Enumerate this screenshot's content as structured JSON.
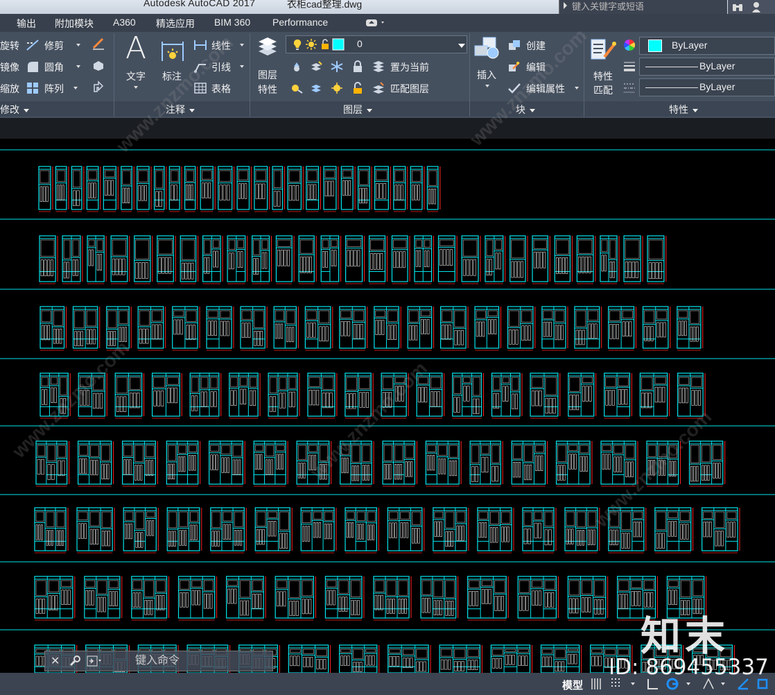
{
  "titlebar": {
    "app_title": "Autodesk AutoCAD 2017",
    "file_name": "衣柜cad整理.dwg",
    "search_placeholder": "键入关键字或短语"
  },
  "tabs": [
    "输出",
    "附加模块",
    "A360",
    "精选应用",
    "BIM 360",
    "Performance"
  ],
  "ribbon": {
    "modify": {
      "rotate": "旋转",
      "mirror": "镜像",
      "scale": "缩放",
      "trim": "修剪",
      "fillet": "圆角",
      "array": "阵列",
      "title": "修改"
    },
    "annotation": {
      "text": "文字",
      "dimension": "标注",
      "linear": "线性",
      "leader": "引线",
      "table": "表格",
      "title": "注释"
    },
    "layers": {
      "layer_properties": "图层\n特性",
      "layer_properties_l1": "图层",
      "layer_properties_l2": "特性",
      "current_layer": "0",
      "set_current": "置为当前",
      "match_layer": "匹配图层",
      "title": "图层",
      "layer_color": "#00e5ee"
    },
    "block": {
      "insert": "插入",
      "create": "创建",
      "edit": "编辑",
      "edit_attributes": "编辑属性",
      "title": "块"
    },
    "properties": {
      "match_l1": "特性",
      "match_l2": "匹配",
      "color": "ByLayer",
      "linetype": "ByLayer",
      "lineweight": "ByLayer",
      "title": "特性",
      "color_swatch": "#00ffff"
    }
  },
  "command": {
    "placeholder": "键入命令"
  },
  "status": {
    "model_tab": "模型"
  },
  "watermark": {
    "logo": "知末",
    "id": "ID: 869455337"
  },
  "colors": {
    "drawing_lines": "#00e5ee",
    "dimension_red": "#ff2020",
    "detail_white": "#e6e6e6",
    "ribbon_bg": "#45505f"
  },
  "drawing": {
    "rows": [
      {
        "cabinet_count": 24
      },
      {
        "cabinet_count": 27
      },
      {
        "cabinet_count": 20
      },
      {
        "cabinet_count": 19
      },
      {
        "cabinet_count": 16
      },
      {
        "cabinet_count": 16
      },
      {
        "cabinet_count": 14
      },
      {
        "cabinet_count": 15
      }
    ]
  }
}
